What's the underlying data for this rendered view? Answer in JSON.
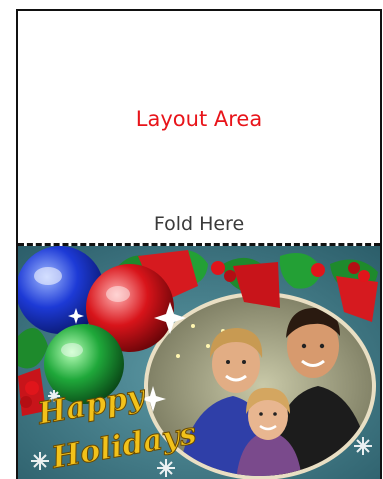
{
  "card": {
    "layout_area_label": "Layout Area",
    "fold_label": "Fold Here",
    "greeting_line1": "Happy",
    "greeting_line2": "Holidays"
  },
  "colors": {
    "layout_label": "#e8141a",
    "fold_label": "#3a3a3a",
    "background_teal": "#3d7a86",
    "greeting_gold": "#f2c21a"
  },
  "icons": [
    "ornament-icon",
    "holly-icon",
    "snowflake-icon",
    "sparkle-icon",
    "family-photo"
  ]
}
